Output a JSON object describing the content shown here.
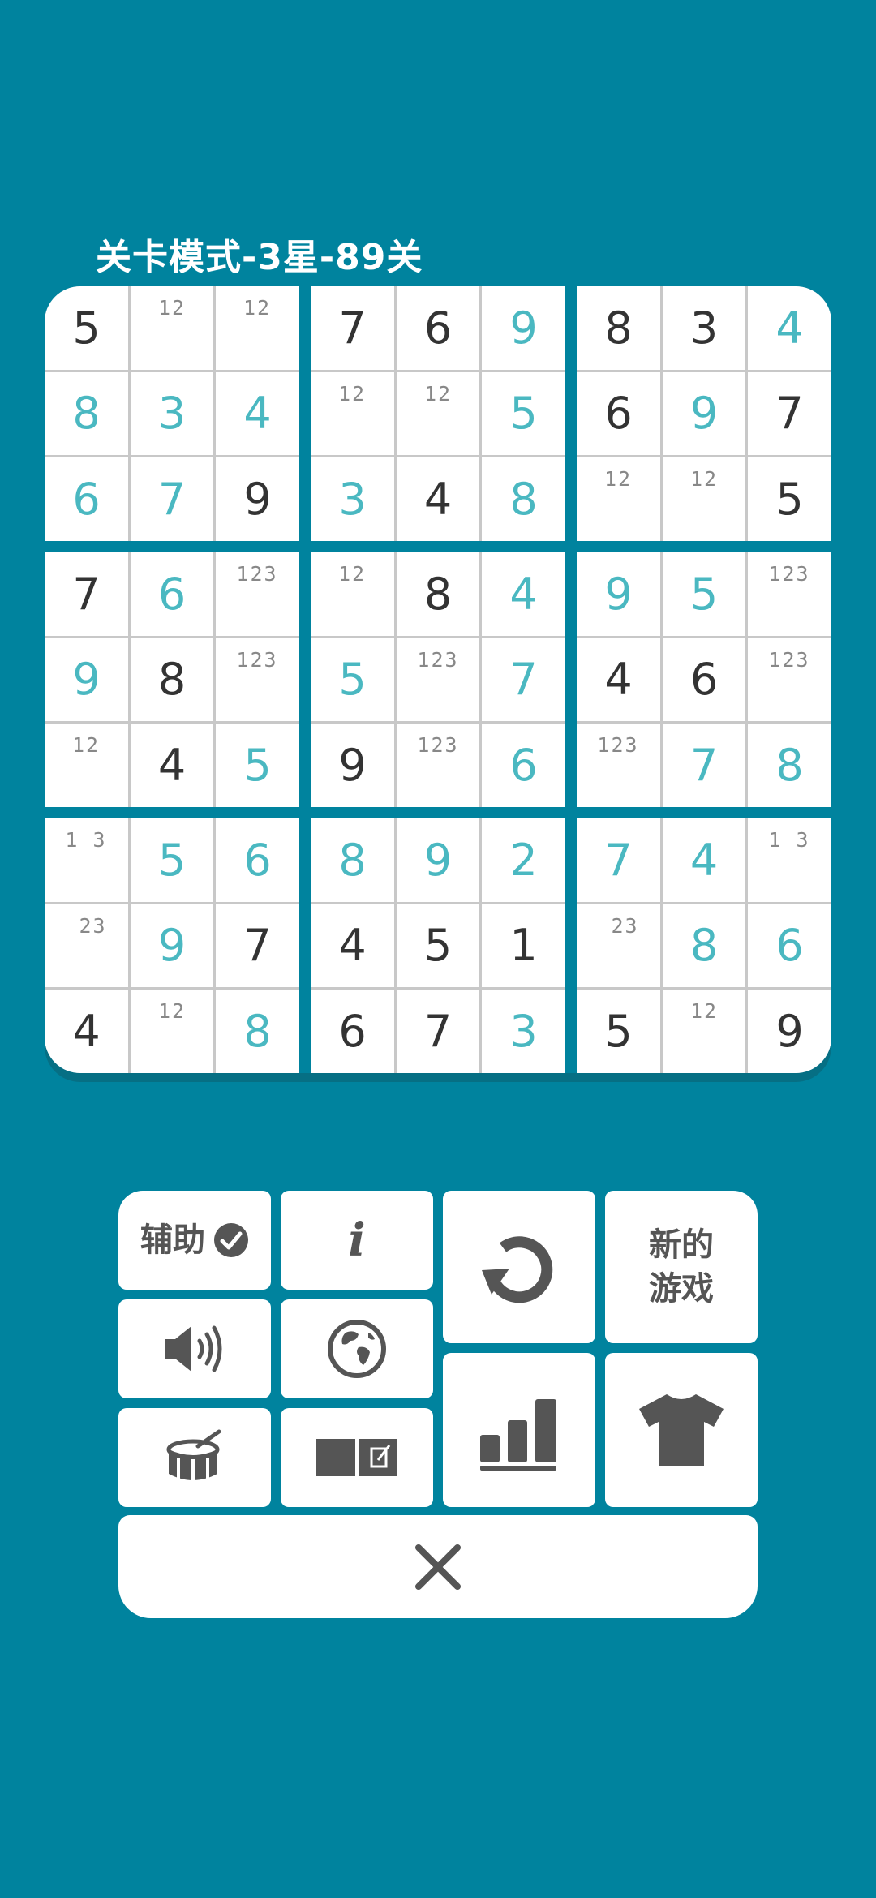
{
  "title": "关卡模式-3星-89关",
  "colors": {
    "background": "#00839e",
    "given_digit": "#333333",
    "entered_digit": "#4ab8c1",
    "notes": "#888888",
    "icon": "#555555"
  },
  "grid": [
    [
      {
        "v": "5",
        "t": "g"
      },
      {
        "n": "12"
      },
      {
        "n": "12"
      },
      {
        "v": "7",
        "t": "g"
      },
      {
        "v": "6",
        "t": "g"
      },
      {
        "v": "9",
        "t": "e"
      },
      {
        "v": "8",
        "t": "g"
      },
      {
        "v": "3",
        "t": "g"
      },
      {
        "v": "4",
        "t": "e"
      }
    ],
    [
      {
        "v": "8",
        "t": "e"
      },
      {
        "v": "3",
        "t": "e"
      },
      {
        "v": "4",
        "t": "e"
      },
      {
        "n": "12"
      },
      {
        "n": "12"
      },
      {
        "v": "5",
        "t": "e"
      },
      {
        "v": "6",
        "t": "g"
      },
      {
        "v": "9",
        "t": "e"
      },
      {
        "v": "7",
        "t": "g"
      }
    ],
    [
      {
        "v": "6",
        "t": "e"
      },
      {
        "v": "7",
        "t": "e"
      },
      {
        "v": "9",
        "t": "g"
      },
      {
        "v": "3",
        "t": "e"
      },
      {
        "v": "4",
        "t": "g"
      },
      {
        "v": "8",
        "t": "e"
      },
      {
        "n": "12"
      },
      {
        "n": "12"
      },
      {
        "v": "5",
        "t": "g"
      }
    ],
    [
      {
        "v": "7",
        "t": "g"
      },
      {
        "v": "6",
        "t": "e"
      },
      {
        "n": "123"
      },
      {
        "n": "12"
      },
      {
        "v": "8",
        "t": "g"
      },
      {
        "v": "4",
        "t": "e"
      },
      {
        "v": "9",
        "t": "e"
      },
      {
        "v": "5",
        "t": "e"
      },
      {
        "n": "123"
      }
    ],
    [
      {
        "v": "9",
        "t": "e"
      },
      {
        "v": "8",
        "t": "g"
      },
      {
        "n": "123"
      },
      {
        "v": "5",
        "t": "e"
      },
      {
        "n": "123"
      },
      {
        "v": "7",
        "t": "e"
      },
      {
        "v": "4",
        "t": "g"
      },
      {
        "v": "6",
        "t": "g"
      },
      {
        "n": "123"
      }
    ],
    [
      {
        "n": "12"
      },
      {
        "v": "4",
        "t": "g"
      },
      {
        "v": "5",
        "t": "e"
      },
      {
        "v": "9",
        "t": "g"
      },
      {
        "n": "123"
      },
      {
        "v": "6",
        "t": "e"
      },
      {
        "n": "123"
      },
      {
        "v": "7",
        "t": "e"
      },
      {
        "v": "8",
        "t": "e"
      }
    ],
    [
      {
        "n": "1 3"
      },
      {
        "v": "5",
        "t": "e"
      },
      {
        "v": "6",
        "t": "e"
      },
      {
        "v": "8",
        "t": "e"
      },
      {
        "v": "9",
        "t": "e"
      },
      {
        "v": "2",
        "t": "e"
      },
      {
        "v": "7",
        "t": "e"
      },
      {
        "v": "4",
        "t": "e"
      },
      {
        "n": "1 3"
      }
    ],
    [
      {
        "n": " 23"
      },
      {
        "v": "9",
        "t": "e"
      },
      {
        "v": "7",
        "t": "g"
      },
      {
        "v": "4",
        "t": "g"
      },
      {
        "v": "5",
        "t": "g"
      },
      {
        "v": "1",
        "t": "g"
      },
      {
        "n": " 23"
      },
      {
        "v": "8",
        "t": "e"
      },
      {
        "v": "6",
        "t": "e"
      }
    ],
    [
      {
        "v": "4",
        "t": "g"
      },
      {
        "n": "12"
      },
      {
        "v": "8",
        "t": "e"
      },
      {
        "v": "6",
        "t": "g"
      },
      {
        "v": "7",
        "t": "g"
      },
      {
        "v": "3",
        "t": "e"
      },
      {
        "v": "5",
        "t": "g"
      },
      {
        "n": "12"
      },
      {
        "v": "9",
        "t": "g"
      }
    ]
  ],
  "controls": {
    "assist_label": "辅助",
    "info_glyph": "i",
    "new_game_line1": "新的",
    "new_game_line2": "游戏",
    "icons": {
      "assist": "check-circle-icon",
      "info": "info-icon",
      "restart": "restart-icon",
      "sound": "speaker-icon",
      "language": "globe-icon",
      "stats": "bar-chart-icon",
      "theme": "tshirt-icon",
      "music": "drum-icon",
      "notes_mode": "notes-toggle-icon",
      "close": "close-icon"
    }
  }
}
